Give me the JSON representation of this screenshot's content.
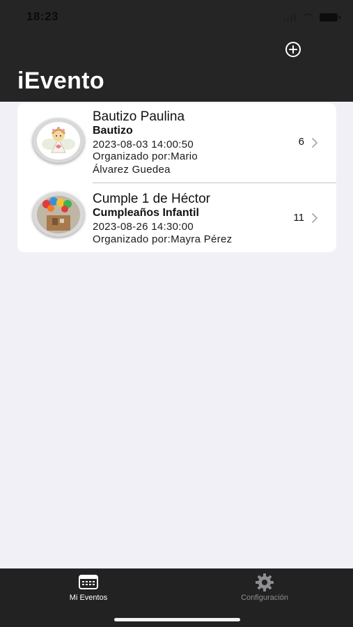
{
  "status_bar": {
    "time": "18:23"
  },
  "header": {
    "title": "iEvento",
    "add_icon": "plus-circle-icon"
  },
  "events": [
    {
      "title": "Bautizo Paulina",
      "type": "Bautizo",
      "datetime": "2023-08-03 14:00:50",
      "organizer_line1": "Organizado por:Mario",
      "organizer_line2": "Álvarez Guedea",
      "count": "6"
    },
    {
      "title": "Cumple  1 de Héctor",
      "type": "Cumpleaños Infantil",
      "datetime": "2023-08-26 14:30:00",
      "organizer_line1": "Organizado por:Mayra Pérez",
      "count": "11"
    }
  ],
  "tabbar": {
    "tabs": [
      {
        "label": "Mi Eventos",
        "icon": "calendar-icon",
        "active": true,
        "color": "#ffffff"
      },
      {
        "label": "Configuración",
        "icon": "gear-icon",
        "active": false,
        "color": "#8e8e93"
      }
    ]
  },
  "colors": {
    "header_bg": "#252525",
    "page_bg": "#f1f0f6",
    "tabbar_bg": "#222222"
  }
}
